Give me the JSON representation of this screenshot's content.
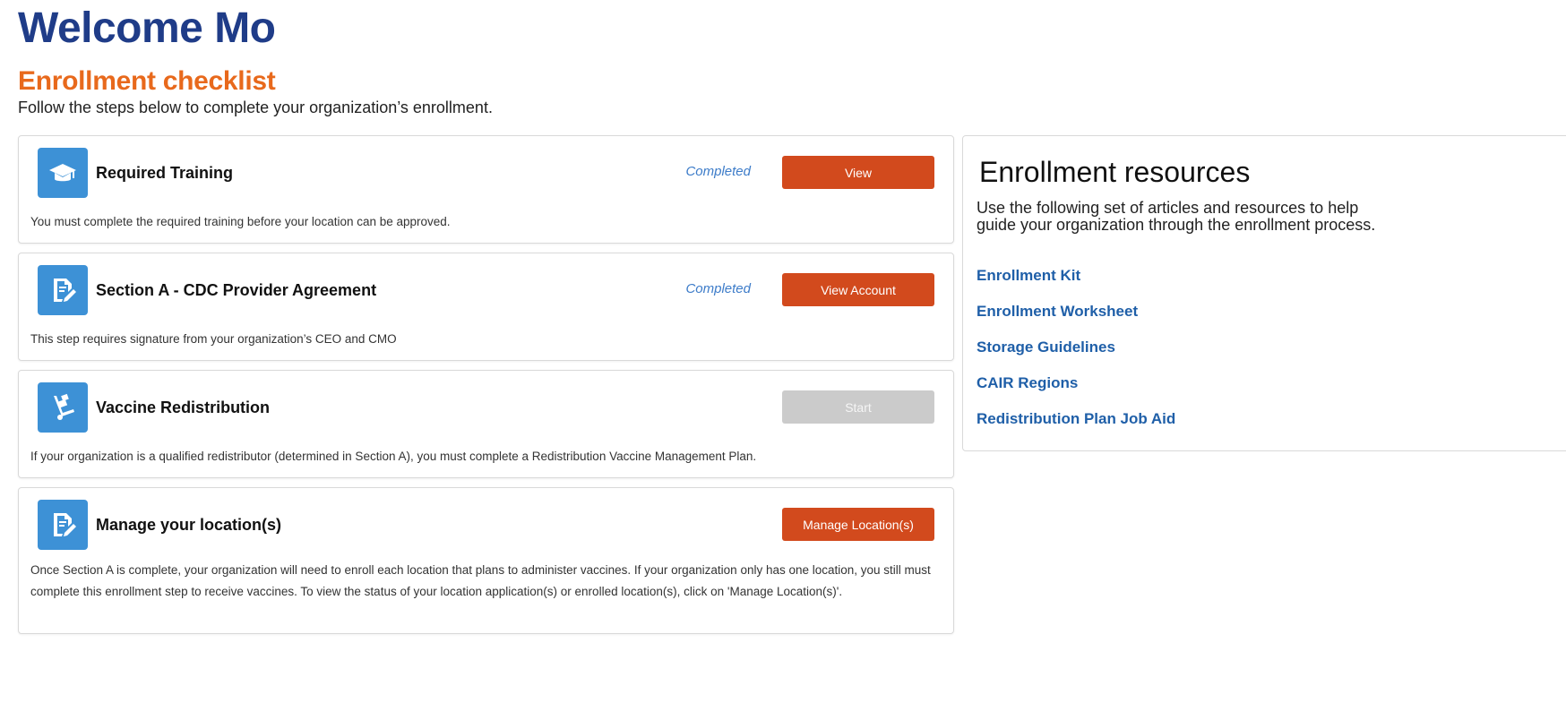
{
  "welcome_title": "Welcome Mo",
  "checklist": {
    "heading": "Enrollment checklist",
    "subtitle": "Follow the steps below to complete your organization’s enrollment.",
    "steps": [
      {
        "title": "Required Training",
        "icon": "graduation-cap-icon",
        "status": "Completed",
        "button": "View",
        "button_enabled": true,
        "description": "You must complete the required training before your location can be approved."
      },
      {
        "title": "Section A - CDC Provider Agreement",
        "icon": "document-edit-icon",
        "status": "Completed",
        "button": "View Account",
        "button_enabled": true,
        "description": "This step requires signature from your organization’s CEO and CMO"
      },
      {
        "title": "Vaccine Redistribution",
        "icon": "hand-truck-icon",
        "status": "",
        "button": "Start",
        "button_enabled": false,
        "description": "If your organization is a qualified redistributor (determined in Section A), you must complete a Redistribution Vaccine Management Plan."
      },
      {
        "title": "Manage your location(s)",
        "icon": "document-edit-icon",
        "status": "",
        "button": "Manage Location(s)",
        "button_enabled": true,
        "description": "Once Section A is complete, your organization will need to enroll each location that plans to administer vaccines. If your organization only has one location, you still must complete this enrollment step to receive vaccines. To view the status of your location application(s) or enrolled location(s), click on 'Manage Location(s)'."
      }
    ]
  },
  "resources": {
    "title": "Enrollment resources",
    "description": "Use the following set of articles and resources to help guide your organization through the enrollment process.",
    "links": [
      "Enrollment Kit",
      "Enrollment Worksheet",
      "Storage Guidelines",
      "CAIR Regions",
      "Redistribution Plan Job Aid"
    ]
  },
  "colors": {
    "title_blue": "#1f3c88",
    "heading_orange": "#e8691c",
    "button_red": "#d24a1d",
    "icon_blue": "#3d91d6",
    "link_blue": "#1f5fa8",
    "status_blue": "#3d7cc9",
    "disabled_gray": "#cbcbcb"
  }
}
